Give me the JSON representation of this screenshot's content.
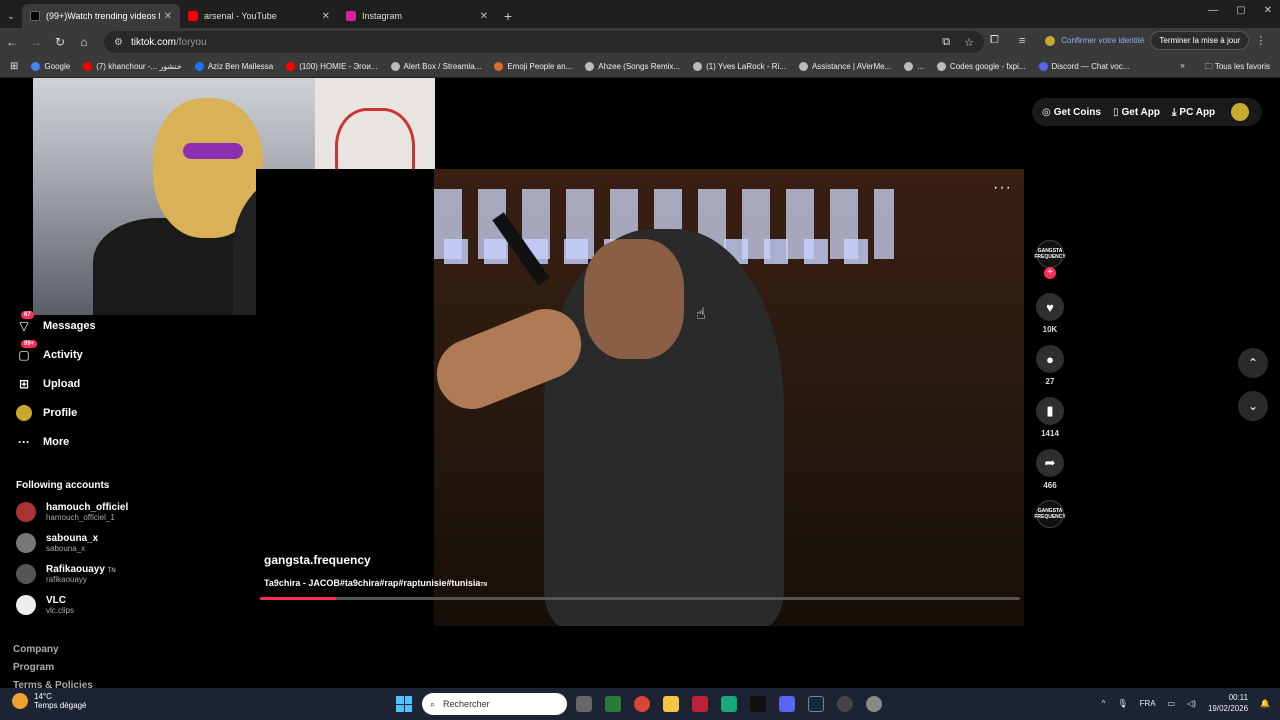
{
  "browser": {
    "tabs": [
      {
        "title": "(99+)Watch trending videos fo",
        "fav_color": "#111"
      },
      {
        "title": "arsenal - YouTube",
        "fav_color": "#ff0000"
      },
      {
        "title": "Instagram",
        "fav_color": "#d6249f"
      }
    ],
    "url_host": "tiktok.com",
    "url_path": "/foryou",
    "profile_action": "Confirmer votre identité",
    "update_button": "Terminer la mise à jour"
  },
  "bookmarks": [
    {
      "label": "Google",
      "color": "#4285f4"
    },
    {
      "label": "(7) khanchour -... خنشور",
      "color": "#ff0000"
    },
    {
      "label": "Aziz Ben Mallessa",
      "color": "#1877f2"
    },
    {
      "label": "(100) HOMIE - Эгои...",
      "color": "#ff0000"
    },
    {
      "label": "Alert Box / Streamla...",
      "color": "#bbbbbb"
    },
    {
      "label": "Emoji People an...",
      "color": "#e06a2a"
    },
    {
      "label": "Ahzee (Songs Remix...",
      "color": "#bbbbbb"
    },
    {
      "label": "(1) Yves LaRock - Ri...",
      "color": "#bbbbbb"
    },
    {
      "label": "Assistance | AVerMe...",
      "color": "#bbbbbb"
    },
    {
      "label": "...",
      "color": "#bbbbbb"
    },
    {
      "label": "Codes google - fxpi...",
      "color": "#bbbbbb"
    },
    {
      "label": "Discord — Chat voc...",
      "color": "#5865f2"
    }
  ],
  "bookmarks_all": "Tous les favoris",
  "sidebar": {
    "nav": [
      {
        "label": "Messages",
        "icon": "paper-plane-icon",
        "glyph": "▽",
        "badge": "67"
      },
      {
        "label": "Activity",
        "icon": "inbox-icon",
        "glyph": "▢",
        "badge": "99+"
      },
      {
        "label": "Upload",
        "icon": "plus-square-icon",
        "glyph": "⊞",
        "badge": ""
      },
      {
        "label": "Profile",
        "icon": "avatar-icon",
        "glyph": "●",
        "badge": ""
      },
      {
        "label": "More",
        "icon": "more-icon",
        "glyph": "···",
        "badge": ""
      }
    ],
    "following_title": "Following accounts",
    "accounts": [
      {
        "name": "hamouch_officiel",
        "user": "hamouch_officiel_1",
        "tag": ""
      },
      {
        "name": "sabouna_x",
        "user": "sabouna_x",
        "tag": ""
      },
      {
        "name": "Rafikaouayy",
        "user": "rafikaouayy",
        "tag": "TN"
      },
      {
        "name": "VLC",
        "user": "vlc.clips",
        "tag": ""
      }
    ],
    "footer": [
      "Company",
      "Program",
      "Terms & Policies"
    ]
  },
  "top_actions": {
    "get_coins": "Get Coins",
    "get_app": "Get App",
    "pc_app": "PC App"
  },
  "video": {
    "author": "gangsta.frequency",
    "description": "Ta9chira - JACOB#ta9chira#rap#raptunisie#tunisia",
    "description_tag": "TN",
    "progress": 0.1,
    "creator_label": "GANGSTA FREQUENCY",
    "actions": {
      "likes": "10K",
      "comments": "27",
      "saves": "1414",
      "shares": "466"
    }
  },
  "taskbar": {
    "temperature": "14°C",
    "weather": "Temps dégagé",
    "search_placeholder": "Rechercher",
    "language": "FRA",
    "time": "00:11",
    "date": "19/02/2026"
  }
}
